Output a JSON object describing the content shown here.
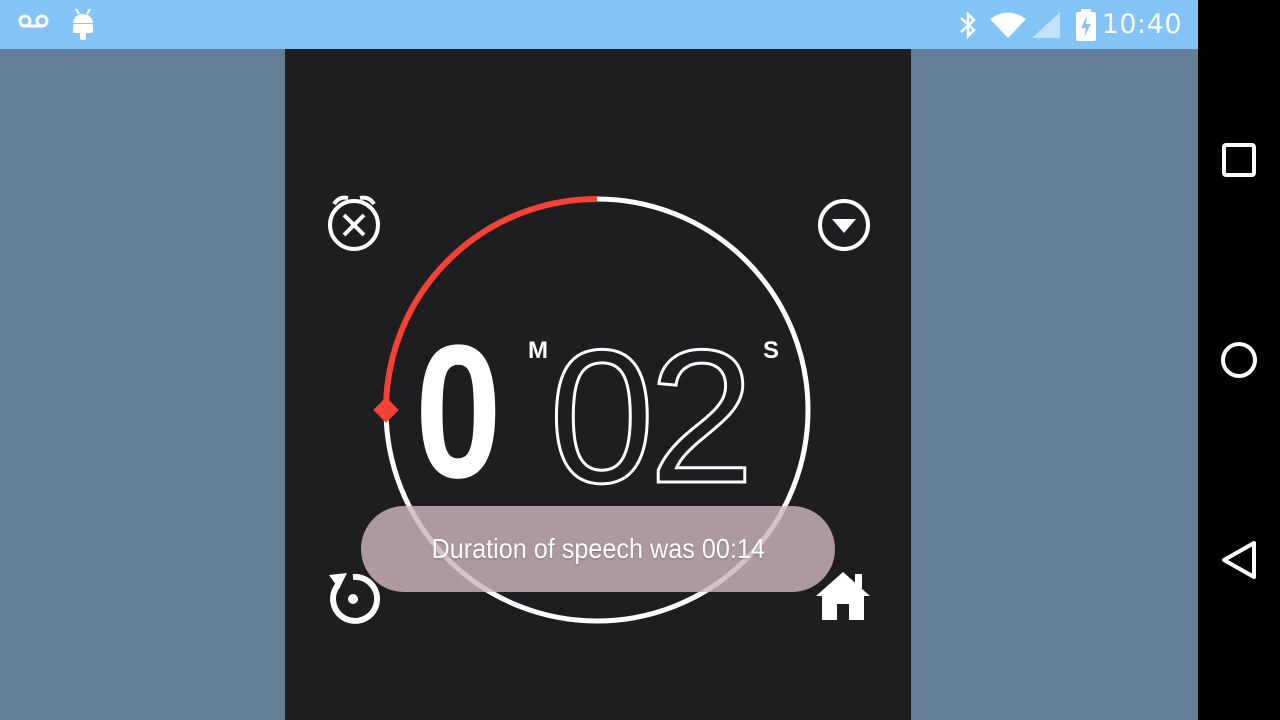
{
  "status_bar": {
    "time": "10:40",
    "icons": [
      "voicemail-icon",
      "android-icon",
      "bluetooth-icon",
      "wifi-icon",
      "signal-icon",
      "battery-charging-icon"
    ],
    "background": "#84c3f5"
  },
  "timer": {
    "minutes": "0",
    "seconds": "02",
    "minutes_unit": "M",
    "seconds_unit": "S",
    "progress_fraction": 0.25,
    "progress_color": "#f44336",
    "ring_color": "#ffffff"
  },
  "buttons": {
    "top_left": "alarm-off-icon",
    "top_right": "dropdown-icon",
    "bottom_left": "reset-icon",
    "bottom_right": "home-icon"
  },
  "toast": {
    "message": "Duration of speech was 00:14"
  },
  "navigation_bar": {
    "buttons": [
      "recents-button",
      "home-button",
      "back-button"
    ]
  }
}
